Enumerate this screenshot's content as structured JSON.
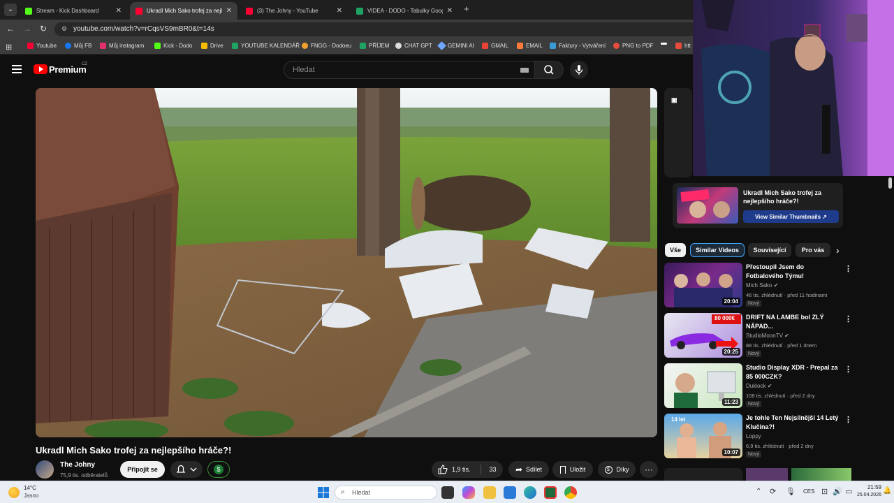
{
  "browser": {
    "tabs": [
      {
        "title": "Stream - Kick Dashboard",
        "active": false,
        "favicon_color": "#53fc18"
      },
      {
        "title": "Ukradl Mich Sako trofej za nejle",
        "active": true,
        "favicon_color": "#ff0033"
      },
      {
        "title": "(3) The Johny - YouTube",
        "active": false,
        "favicon_color": "#ff0033"
      },
      {
        "title": "VIDEA - DODO - Tabulky Googl",
        "active": false,
        "favicon_color": "#1ea362"
      }
    ],
    "new_tab": "+",
    "url": "youtube.com/watch?v=rCqsVS9mBR0&t=14s",
    "bookmarks": [
      {
        "label": "Youtube",
        "color": "#ff0033"
      },
      {
        "label": "Můj FB",
        "color": "#1877f2"
      },
      {
        "label": "Můj instagram",
        "color": "#e1306c"
      },
      {
        "label": "Kick - Dodo",
        "color": "#53fc18"
      },
      {
        "label": "Drive",
        "color": "#fbbc04"
      },
      {
        "label": "YOUTUBE KALENDÁŘ",
        "color": "#1ea362"
      },
      {
        "label": "FNGG - Dodoeu",
        "color": "#f0a030"
      },
      {
        "label": "PŘÍJEM",
        "color": "#1ea362"
      },
      {
        "label": "CHAT GPT",
        "color": "#dddddd"
      },
      {
        "label": "GEMINI AI",
        "color": "#6fa8ff"
      },
      {
        "label": "GMAIL",
        "color": "#ea4335"
      },
      {
        "label": "EMAIL",
        "color": "#ff7a3a"
      },
      {
        "label": "Faktury - Vytváření",
        "color": "#3a9bd9"
      },
      {
        "label": "PNG to PDF",
        "color": "#e74c3c"
      },
      {
        "label": "",
        "color": "#ffffff"
      },
      {
        "label": "htt",
        "color": "#e74c3c"
      }
    ]
  },
  "youtube": {
    "brand": "Premium",
    "country": "CZ",
    "search_placeholder": "Hledat",
    "video": {
      "title": "Ukradl Mich Sako trofej za nejlepšího hráče?!",
      "channel": "The Johny",
      "subscribers": "75,9 tis. odběratelů",
      "join_label": "Připojit se",
      "likes": "1,9 tis.",
      "dislikes": "33",
      "share_label": "Sdílet",
      "save_label": "Uložit",
      "thanks_label": "Díky"
    },
    "promo": {
      "title": "Ukradl Mich Sako trofej za nejlepšího hráče?!",
      "button": "View Similar Thumbnails ↗"
    },
    "chips": [
      "Vše",
      "Similar Videos",
      "Související",
      "Pro vás"
    ],
    "recommendations": [
      {
        "title": "Přestoupil Jsem do Fotbalového Týmu!",
        "channel": "Mich Sako",
        "meta": "46 tis. zhlédnutí · před 11 hodinami",
        "badge": "Nový",
        "duration": "20:04"
      },
      {
        "title": "DRIFT NA LAMBE bol ZLÝ NÁPAD...",
        "channel": "StudioMoonTV",
        "meta": "88 tis. zhlédnutí · před 1 dnem",
        "badge": "Nový",
        "duration": "20:25",
        "thumb_text": "80 000€"
      },
      {
        "title": "Studio Display XDR - Prepal za 85 000CZK?",
        "channel": "Duklock",
        "meta": "108 tis. zhlédnutí · před 2 dny",
        "badge": "Nový",
        "duration": "11:23"
      },
      {
        "title": "Je tohle Ten Nejsilnější 14 Letý Klučina?!",
        "channel": "Loppy",
        "meta": "6,9 tis. zhlédnutí · před 2 dny",
        "badge": "Nový",
        "duration": "10:07",
        "thumb_text": "14 let"
      }
    ]
  },
  "taskbar": {
    "weather_temp": "14°C",
    "weather_desc": "Jasno",
    "search_placeholder": "Hledat",
    "lang": "CES",
    "time": "21:59",
    "date": "25.04.2026"
  }
}
